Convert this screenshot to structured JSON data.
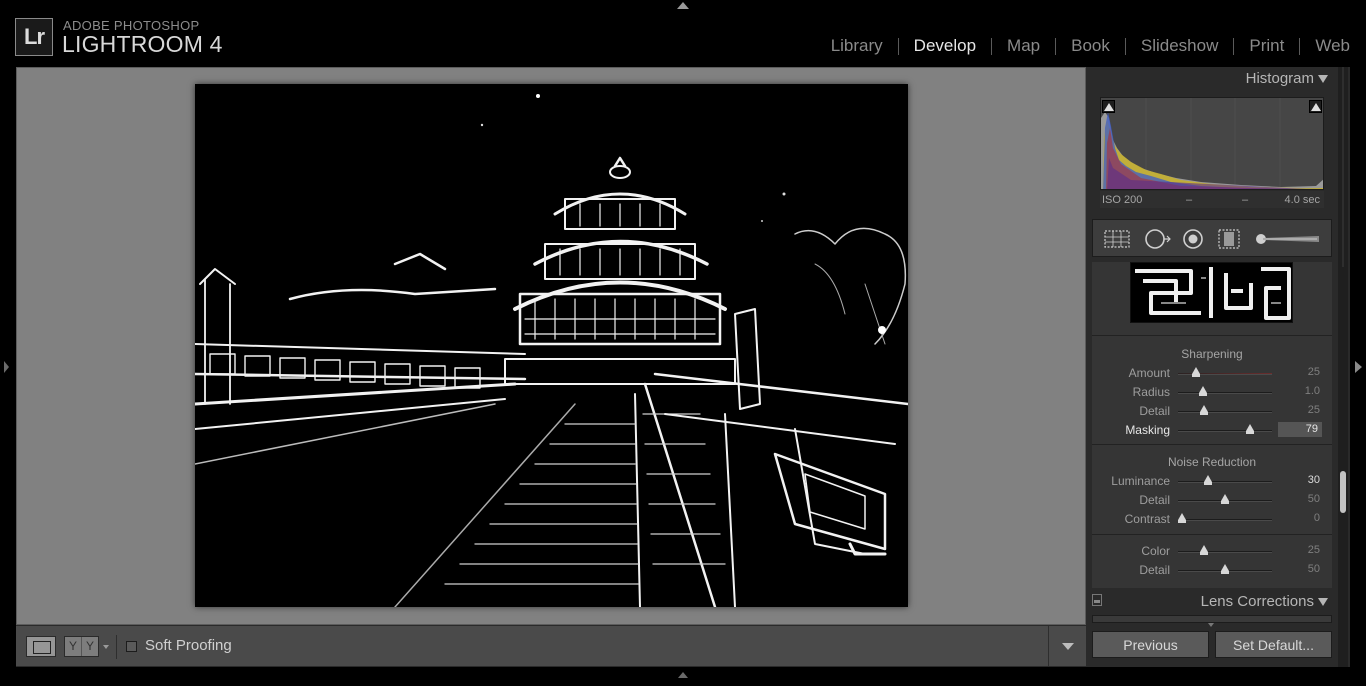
{
  "app": {
    "badge": "Lr",
    "brand_top": "ADOBE PHOTOSHOP",
    "brand_main": "LIGHTROOM 4"
  },
  "modules": [
    {
      "label": "Library",
      "active": false
    },
    {
      "label": "Develop",
      "active": true
    },
    {
      "label": "Map",
      "active": false
    },
    {
      "label": "Book",
      "active": false
    },
    {
      "label": "Slideshow",
      "active": false
    },
    {
      "label": "Print",
      "active": false
    },
    {
      "label": "Web",
      "active": false
    }
  ],
  "toolbar": {
    "yy_left": "Y",
    "yy_right": "Y",
    "soft_proofing_label": "Soft Proofing",
    "soft_proofing_checked": false
  },
  "histogram": {
    "title": "Histogram",
    "iso": "ISO 200",
    "focal": "–",
    "aperture": "–",
    "shutter": "4.0 sec"
  },
  "sharpening": {
    "title": "Sharpening",
    "rows": [
      {
        "label": "Amount",
        "value": "25",
        "fraction": 0.167
      },
      {
        "label": "Radius",
        "value": "1.0",
        "fraction": 0.241
      },
      {
        "label": "Detail",
        "value": "25",
        "fraction": 0.25
      },
      {
        "label": "Masking",
        "value": "79",
        "fraction": 0.79
      }
    ]
  },
  "noise_reduction": {
    "title": "Noise Reduction",
    "rows": [
      {
        "label": "Luminance",
        "value": "30",
        "fraction": 0.3
      },
      {
        "label": "Detail",
        "value": "50",
        "fraction": 0.5
      },
      {
        "label": "Contrast",
        "value": "0",
        "fraction": 0.0
      }
    ],
    "color_rows": [
      {
        "label": "Color",
        "value": "25",
        "fraction": 0.25
      },
      {
        "label": "Detail",
        "value": "50",
        "fraction": 0.5
      }
    ]
  },
  "lens_corrections": {
    "title": "Lens Corrections"
  },
  "buttons": {
    "previous": "Previous",
    "set_default": "Set Default..."
  },
  "icons": {
    "crop": "crop-overlay-icon",
    "spot": "spot-removal-icon",
    "redeye": "red-eye-icon",
    "gradient": "graduated-filter-icon",
    "brush": "adjustment-brush-icon"
  },
  "colors": {
    "accent": "#e6e6e6",
    "panel_bg": "#2a2a2a",
    "canvas_bg": "#818181"
  }
}
